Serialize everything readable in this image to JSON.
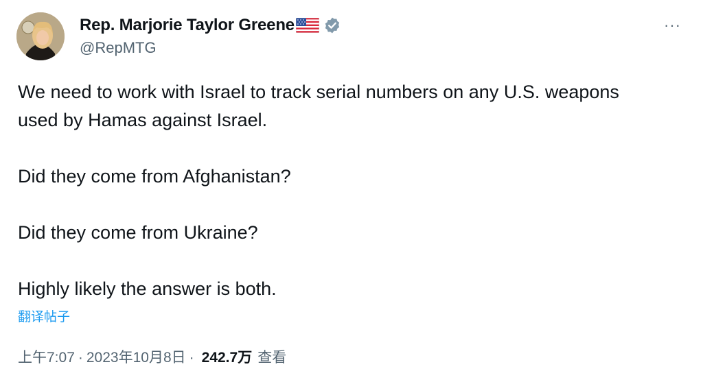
{
  "author": {
    "display_name": "Rep. Marjorie Taylor Greene",
    "flag_icon": "us-flag-icon",
    "verified_icon": "verified-badge-icon",
    "handle": "@RepMTG",
    "avatar": "avatar"
  },
  "menu": {
    "more_label": "···"
  },
  "tweet": {
    "lines": [
      "We need to work with Israel to track serial numbers on any U.S. weapons",
      "used by Hamas against Israel.",
      "Did they come from Afghanistan?",
      "Did they come from Ukraine?",
      "Highly likely the answer is both."
    ]
  },
  "translate_label": "翻译帖子",
  "meta": {
    "time": "上午7:07",
    "separator": "·",
    "date": "2023年10月8日",
    "views_count": "242.7万",
    "views_label": "查看"
  },
  "colors": {
    "text": "#0f1419",
    "secondary": "#536471",
    "link": "#1d9bf0",
    "verified": "#829aab"
  }
}
